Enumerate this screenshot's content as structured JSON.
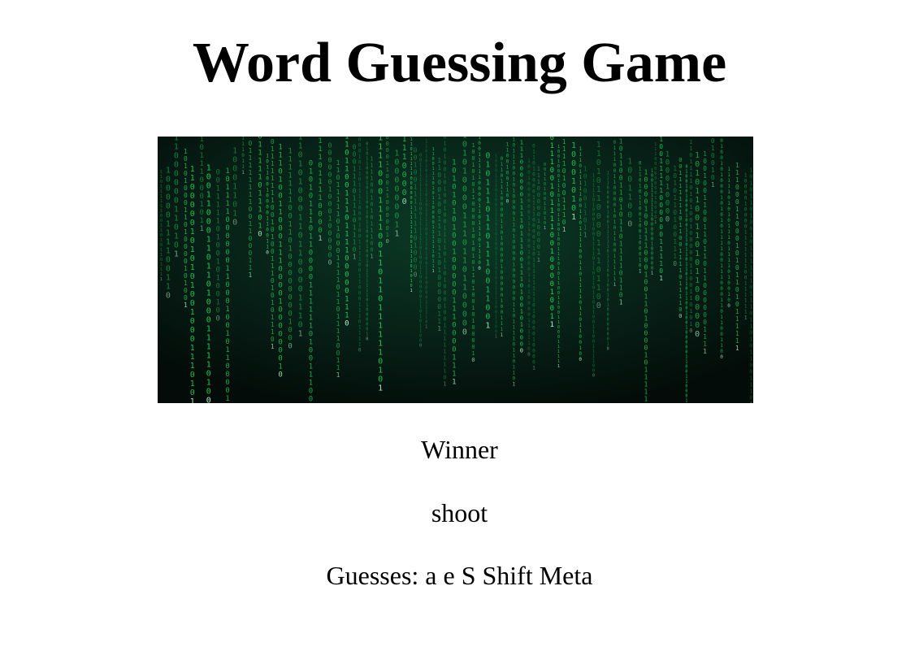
{
  "page": {
    "title": "Word Guessing Game"
  },
  "hero_image": {
    "description": "matrix-code-rain",
    "background_color": "#04110b",
    "glyph_color": "#1fd65a",
    "glyph_bright_color": "#b8ffcf"
  },
  "game": {
    "status": "Winner",
    "word": "shoot",
    "guesses_label": "Guesses:",
    "guesses": [
      "a",
      "e",
      "S",
      "Shift",
      "Meta"
    ]
  }
}
